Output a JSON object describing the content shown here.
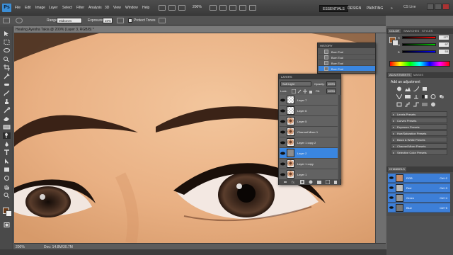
{
  "menubar": {
    "logo": "Ps",
    "items": [
      "File",
      "Edit",
      "Image",
      "Layer",
      "Select",
      "Filter",
      "Analysis",
      "3D",
      "View",
      "Window",
      "Help"
    ],
    "zoom": "200%",
    "workspaces": [
      "ESSENTIALS",
      "DESIGN",
      "PAINTING"
    ],
    "more": "»",
    "cslive": "CS Live"
  },
  "options": {
    "range_label": "Range:",
    "range_value": "Midtones",
    "exposure_label": "Exposure:",
    "exposure_value": "10%",
    "protect_tones_label": "Protect Tones"
  },
  "document": {
    "tab_label": "Healing Ayesha Takia @ 200% (Layer 3, RGB/8) *",
    "zoom_status": "200%",
    "doc_status": "Doc: 14.8M/30.7M"
  },
  "color_panel": {
    "tabs": [
      "COLOR",
      "SWATCHES",
      "STYLES"
    ],
    "rows": [
      {
        "label": "R",
        "value": "177",
        "color": "#ff0000"
      },
      {
        "label": "G",
        "value": "97",
        "color": "#00aa00"
      },
      {
        "label": "B",
        "value": "53",
        "color": "#0000ff"
      }
    ],
    "fg": "#9a5a2a",
    "bg": "#e0e0e0"
  },
  "adjustments": {
    "tabs": [
      "ADJUSTMENTS",
      "MASKS"
    ],
    "title": "Add an adjustment",
    "presets": [
      "Levels Presets",
      "Curves Presets",
      "Exposure Presets",
      "Hue/Saturation Presets",
      "Black & White Presets",
      "Channel Mixer Presets",
      "Selective Color Presets"
    ]
  },
  "channels": {
    "tabs": [
      "CHANNELS"
    ],
    "rows": [
      {
        "name": "RGB",
        "key": "Ctrl+2"
      },
      {
        "name": "Red",
        "key": "Ctrl+3"
      },
      {
        "name": "Green",
        "key": "Ctrl+4"
      },
      {
        "name": "Blue",
        "key": "Ctrl+5"
      }
    ]
  },
  "history": {
    "title": "HISTORY",
    "rows": [
      {
        "name": "Burn Tool",
        "active": false
      },
      {
        "name": "Burn Tool",
        "active": false
      },
      {
        "name": "Burn Tool",
        "active": false
      },
      {
        "name": "Burn Tool",
        "active": true
      }
    ]
  },
  "layers": {
    "title": "LAYERS",
    "blend_mode": "Soft Light",
    "opacity_label": "Opacity:",
    "opacity_value": "100%",
    "lock_label": "Lock:",
    "fill_label": "Fill:",
    "fill_value": "100%",
    "rows": [
      {
        "name": "Layer 7",
        "thumb": "checker",
        "active": false
      },
      {
        "name": "Layer 6",
        "thumb": "checker",
        "active": false
      },
      {
        "name": "Layer 5",
        "thumb": "face",
        "active": false
      },
      {
        "name": "Channel Mixer 1",
        "thumb": "face",
        "active": false
      },
      {
        "name": "Layer 1 copy 2",
        "thumb": "face",
        "active": false
      },
      {
        "name": "Layer 2",
        "thumb": "gray",
        "active": true
      },
      {
        "name": "Layer 1 copy",
        "thumb": "face",
        "active": false
      },
      {
        "name": "Layer 1",
        "thumb": "face",
        "active": false
      }
    ]
  },
  "colors": {
    "accent": "#3a86e0",
    "skin": "#eab487"
  }
}
